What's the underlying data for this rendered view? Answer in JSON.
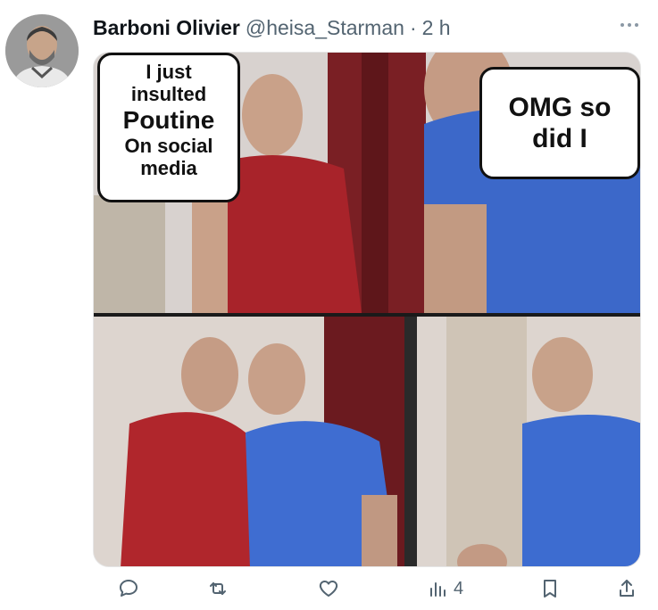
{
  "tweet": {
    "author_name": "Barboni Olivier",
    "handle": "@heisa_Starman",
    "separator": "·",
    "time": "2 h"
  },
  "meme": {
    "bubble_left_lines": [
      "I just",
      "insulted",
      "Poutine",
      "On social",
      "media"
    ],
    "bubble_right_lines": [
      "OMG so",
      "did I"
    ]
  },
  "actions": {
    "reply_icon": "reply-icon",
    "retweet_icon": "retweet-icon",
    "like_icon": "like-icon",
    "views_icon": "views-icon",
    "views_count": "4",
    "bookmark_icon": "bookmark-icon",
    "share_icon": "share-icon"
  }
}
